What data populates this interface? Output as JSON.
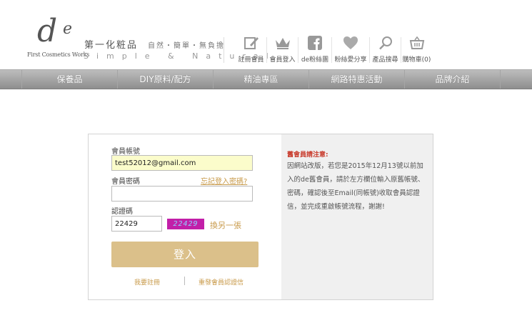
{
  "header": {
    "logo_mark": "d",
    "logo_mark_e": "e",
    "logo_sub": "First Cosmetics Works",
    "brand_name": "第一化粧品",
    "tagline": "自然・簡單・無負擔",
    "tagline_en": "Simple & Natural"
  },
  "tools": [
    {
      "label": "註冊會員",
      "icon": "register-icon"
    },
    {
      "label": "會員登入",
      "icon": "crown-icon"
    },
    {
      "label": "de粉絲團",
      "icon": "facebook-icon"
    },
    {
      "label": "粉絲愛分享",
      "icon": "heart-icon"
    },
    {
      "label": "產品搜尋",
      "icon": "search-icon"
    },
    {
      "label": "購物車(0)",
      "icon": "cart-icon"
    }
  ],
  "nav": [
    "保養品",
    "DIY原料/配方",
    "精油專區",
    "網路特惠活動",
    "品牌介紹"
  ],
  "login": {
    "account_label": "會員帳號",
    "account_value": "test52012@gmail.com",
    "password_label": "會員密碼",
    "forgot_label": "忘記登入密碼?",
    "password_value": "",
    "captcha_label": "認證碼",
    "captcha_value": "22429",
    "captcha_image_text": "22429",
    "captcha_refresh": "換另一張",
    "submit": "登入",
    "register_link": "我要註冊",
    "resend_link": "重發會員認證信"
  },
  "notice": {
    "title": "舊會員請注意:",
    "body": "因網站改版，若您是2015年12月13號以前加入的de舊會員，請於左方欄位輸入原舊帳號、密碼，確認後至Email(同帳號)收取會員認證信，並完成重啟帳號流程，謝謝!"
  },
  "colors": {
    "accent_gold": "#dbc08a",
    "link_gold": "#c89a4a",
    "notice_red": "#c83a2b",
    "input_highlight": "#fbfccb"
  }
}
